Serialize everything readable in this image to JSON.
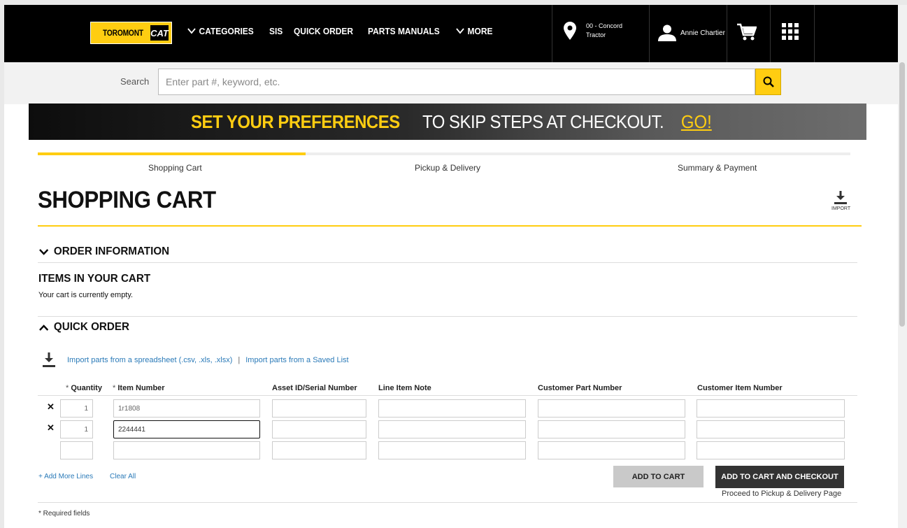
{
  "header": {
    "logo_text": "TOROMONT",
    "logo_badge": "CAT",
    "nav": [
      {
        "label": "CATEGORIES",
        "chevron": true
      },
      {
        "label": "SIS",
        "chevron": false
      },
      {
        "label": "QUICK ORDER",
        "chevron": false
      },
      {
        "label": "PARTS MANUALS",
        "chevron": false
      },
      {
        "label": "MORE",
        "chevron": true
      }
    ],
    "location_line1": "00 - Concord",
    "location_line2": "Tractor",
    "user_name": "Annie Chartier"
  },
  "search": {
    "label": "Search",
    "placeholder": "Enter part #, keyword, etc."
  },
  "banner": {
    "highlight": "SET YOUR PREFERENCES",
    "text": "TO SKIP STEPS AT CHECKOUT.",
    "link": "GO!"
  },
  "steps": [
    "Shopping Cart",
    "Pickup & Delivery",
    "Summary & Payment"
  ],
  "steps_progress": 0.33,
  "page_title": "SHOPPING CART",
  "import_label": "IMPORT",
  "order_info": "ORDER INFORMATION",
  "items_heading": "ITEMS IN YOUR CART",
  "cart_empty": "Your cart is currently empty.",
  "quick_order": {
    "heading": "QUICK ORDER",
    "import_spreadsheet": "Import parts from a spreadsheet (.csv, .xls, .xlsx)",
    "separator": "|",
    "import_saved": "Import parts from a Saved List",
    "required_mark": "*",
    "columns": [
      "Quantity",
      "Item Number",
      "Asset ID/Serial Number",
      "Line Item Note",
      "Customer Part Number",
      "Customer Item Number"
    ],
    "rows": [
      {
        "remove": "✕",
        "qty": "1",
        "item": "1r1808"
      },
      {
        "remove": "✕",
        "qty": "1",
        "item": "2244441"
      },
      {
        "remove": "",
        "qty": "",
        "item": ""
      }
    ],
    "add_more": "+ Add More Lines",
    "clear_all": "Clear All",
    "add_to_cart": "ADD TO CART",
    "add_checkout": "ADD TO CART AND CHECKOUT",
    "proceed": "Proceed to Pickup & Delivery Page"
  },
  "footnote": "* Required fields",
  "colors": {
    "brand_yellow": "#ffcd11",
    "link_blue": "#2a7ab8",
    "header_black": "#000000"
  }
}
